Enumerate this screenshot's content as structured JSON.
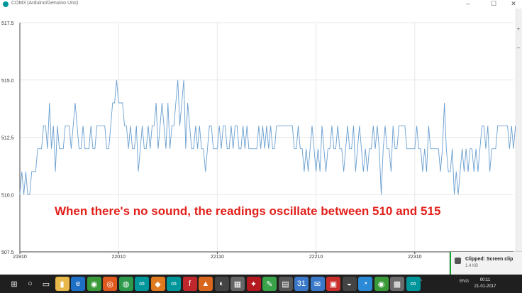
{
  "window": {
    "title": "COM3 (Arduino/Genuino Uno)",
    "minimize": "–",
    "maximize": "☐",
    "close": "✕"
  },
  "side_panel": [
    "+",
    "–"
  ],
  "caption": "When there's no sound, the readings oscillate between 510 and 515",
  "toast": {
    "title": "Clipped: Screen clip",
    "size": "1.4 KB"
  },
  "taskbar": {
    "apps": [
      {
        "icon": "windows-logo-icon",
        "glyph": "⊞",
        "bg": "#1f1f1f"
      },
      {
        "icon": "search-icon",
        "glyph": "○",
        "bg": "#1f1f1f"
      },
      {
        "icon": "task-view-icon",
        "glyph": "▭",
        "bg": "#1f1f1f"
      },
      {
        "icon": "file-explorer-icon",
        "glyph": "▮",
        "bg": "#e8b84a"
      },
      {
        "icon": "edge-icon",
        "glyph": "e",
        "bg": "#1e6fc6"
      },
      {
        "icon": "chrome-icon",
        "glyph": "◉",
        "bg": "#3a9a3a"
      },
      {
        "icon": "ubuntu-icon",
        "glyph": "◎",
        "bg": "#e05a1f"
      },
      {
        "icon": "app-green-icon",
        "glyph": "◍",
        "bg": "#2c9a4a"
      },
      {
        "icon": "arduino-icon",
        "glyph": "∞",
        "bg": "#00979c"
      },
      {
        "icon": "app-orange-icon",
        "glyph": "◆",
        "bg": "#e07a1f"
      },
      {
        "icon": "arduino-icon",
        "glyph": "∞",
        "bg": "#00979c"
      },
      {
        "icon": "fritzing-icon",
        "glyph": "f",
        "bg": "#c0272d"
      },
      {
        "icon": "matlab-icon",
        "glyph": "▲",
        "bg": "#d9661f"
      },
      {
        "icon": "app-icon",
        "glyph": "◐",
        "bg": "#444"
      },
      {
        "icon": "app-icon",
        "glyph": "▦",
        "bg": "#666"
      },
      {
        "icon": "acrobat-icon",
        "glyph": "✦",
        "bg": "#b3191f"
      },
      {
        "icon": "evernote-icon",
        "glyph": "✎",
        "bg": "#3aa34a"
      },
      {
        "icon": "app-icon",
        "glyph": "▤",
        "bg": "#555"
      },
      {
        "icon": "calendar-icon",
        "glyph": "31",
        "bg": "#3a78c9"
      },
      {
        "icon": "mail-icon",
        "glyph": "✉",
        "bg": "#3a78c9"
      },
      {
        "icon": "app-red-icon",
        "glyph": "▣",
        "bg": "#c9302c"
      },
      {
        "icon": "app-icon",
        "glyph": "◒",
        "bg": "#444"
      },
      {
        "icon": "app-icon",
        "glyph": "◔",
        "bg": "#2a8ad6"
      },
      {
        "icon": "chrome-icon",
        "glyph": "◉",
        "bg": "#3a9a3a"
      },
      {
        "icon": "app-icon",
        "glyph": "▩",
        "bg": "#6a6a6a"
      },
      {
        "icon": "arduino-icon",
        "glyph": "∞",
        "bg": "#00979c"
      }
    ],
    "tray": {
      "caret": "^",
      "lang": "ENG"
    },
    "time": "00:11",
    "date": "21-01-2017"
  },
  "chart_data": {
    "type": "line",
    "x_ticks": [
      "21910",
      "22010",
      "22110",
      "22210",
      "22310"
    ],
    "y_ticks": [
      "507.5",
      "510.0",
      "512.5",
      "515.0",
      "517.5"
    ],
    "ylim": [
      507.5,
      517.5
    ],
    "x_range": [
      21910,
      22410
    ],
    "grid": true,
    "colors": {
      "line": "#6a9fd0",
      "grid": "#e8e8e8",
      "axis": "#444"
    },
    "series": [
      {
        "x_start": 21910,
        "x_step": 2,
        "values": [
          510,
          511,
          510,
          511,
          510,
          510,
          511,
          511,
          511,
          512,
          512,
          512,
          513,
          513,
          512,
          514,
          512,
          513,
          511,
          513,
          512,
          512,
          512,
          513,
          513,
          513,
          512,
          513,
          514,
          513,
          512,
          512,
          513,
          512,
          512,
          512,
          513,
          512,
          512,
          513,
          513,
          513,
          513,
          513,
          512,
          512,
          513,
          514,
          514,
          515,
          514,
          514,
          514,
          513,
          513,
          512,
          513,
          512,
          512,
          513,
          511,
          512,
          513,
          512,
          512,
          513,
          512,
          513,
          513,
          514,
          512,
          513,
          514,
          513,
          512,
          514,
          512,
          513,
          513,
          514,
          515,
          513,
          514,
          515,
          512,
          514,
          513,
          512,
          512,
          513,
          512,
          513,
          512,
          512,
          511,
          512,
          513,
          513,
          512,
          512,
          512,
          513,
          512,
          513,
          513,
          512,
          512,
          513,
          512,
          513,
          513,
          512,
          512,
          513,
          512,
          513,
          512,
          512,
          512,
          512,
          512,
          513,
          512,
          513,
          512,
          513,
          512,
          513,
          512,
          512,
          513,
          513,
          513,
          513,
          513,
          513,
          513,
          513,
          513,
          512,
          512,
          513,
          512,
          512,
          511,
          512,
          511,
          512,
          513,
          512,
          511,
          512,
          511,
          513,
          512,
          511,
          512,
          512,
          513,
          512,
          512,
          513,
          512,
          512,
          511,
          512,
          513,
          512,
          512,
          513,
          511,
          512,
          513,
          512,
          511,
          512,
          511,
          512,
          512,
          513,
          512,
          513,
          512,
          510,
          512,
          513,
          512,
          512,
          511,
          513,
          512,
          512,
          513,
          513,
          513,
          513,
          512,
          512,
          512,
          512,
          512,
          513,
          512,
          512,
          511,
          512,
          511,
          513,
          512,
          512,
          512,
          512,
          512,
          511,
          512,
          514,
          512,
          511,
          511,
          512,
          510,
          511,
          510,
          511,
          512,
          511,
          512,
          511,
          512,
          512,
          511,
          512,
          511,
          512,
          513,
          513,
          512,
          513,
          511,
          512,
          512,
          512,
          513,
          513,
          513,
          513,
          513,
          513,
          512,
          513,
          512,
          513,
          512,
          513,
          513,
          512,
          512,
          513,
          511,
          513,
          513,
          514,
          512,
          512,
          511,
          512,
          511,
          511,
          510,
          511,
          512,
          512,
          512,
          511,
          512,
          511,
          512,
          512,
          511,
          511,
          512,
          512,
          512,
          512,
          511
        ]
      }
    ]
  }
}
